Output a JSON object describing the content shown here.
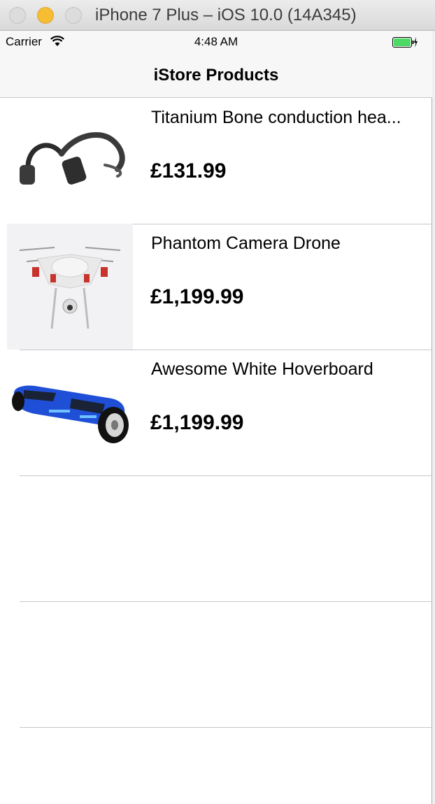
{
  "window": {
    "title": "iPhone 7 Plus – iOS 10.0 (14A345)"
  },
  "status_bar": {
    "carrier": "Carrier",
    "time": "4:48 AM"
  },
  "nav": {
    "title": "iStore Products"
  },
  "products": [
    {
      "name": "Titanium Bone conduction hea...",
      "price": "£131.99",
      "image": "headphones-image"
    },
    {
      "name": "Phantom Camera Drone",
      "price": "£1,199.99",
      "image": "drone-image"
    },
    {
      "name": "Awesome White Hoverboard",
      "price": "£1,199.99",
      "image": "hoverboard-image"
    }
  ],
  "colors": {
    "battery": "#4cd964",
    "hoverboard": "#1e4fd6",
    "separator": "#c8c7cc"
  }
}
